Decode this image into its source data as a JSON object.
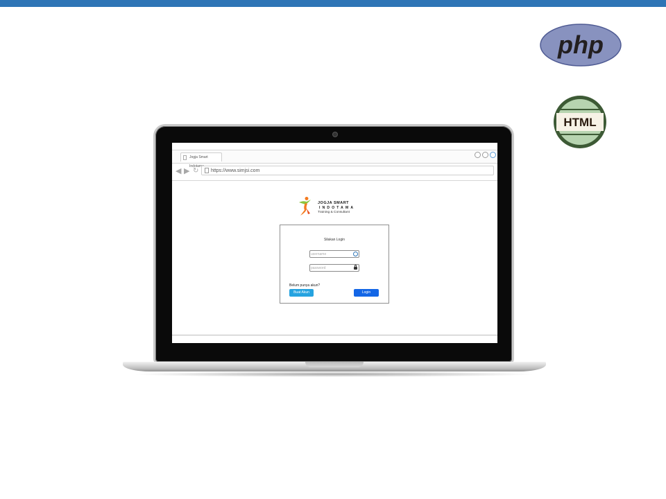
{
  "slide": {
    "accent_color": "#2e75b6",
    "php_logo_text": "php",
    "html_badge_text": "HTML"
  },
  "browser": {
    "tab_title": "Jogja Smart Indotama",
    "back_icon": "back-arrow-icon",
    "forward_icon": "forward-arrow-icon",
    "refresh_icon": "refresh-icon",
    "url": "https://www.simjsi.com"
  },
  "brand": {
    "name": "JOGJA SMART",
    "sub": "INDOTAMA",
    "tagline": "Training & Consultant"
  },
  "login": {
    "title": "Silakan Login",
    "username_placeholder": "username",
    "password_placeholder": "password",
    "signup_prompt": "Belum punya akun?",
    "signup_label": "Buat Akun",
    "login_label": "Login",
    "signup_color": "#26a3e0",
    "login_color": "#1366e6"
  }
}
